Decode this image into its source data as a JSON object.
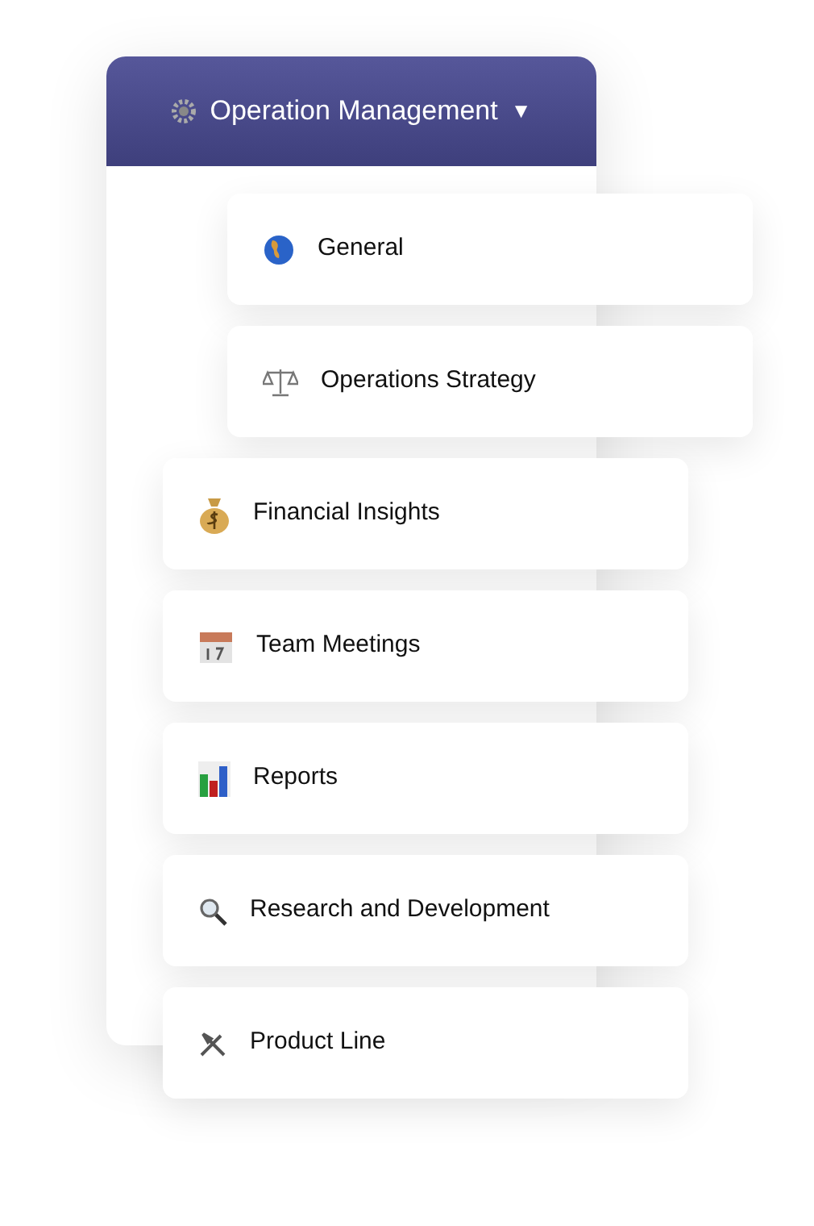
{
  "menu": {
    "title": "Operation Management",
    "caret": "▼",
    "expanded": true
  },
  "items": [
    {
      "label": "General",
      "kind": "sub"
    },
    {
      "label": "Operations Strategy",
      "kind": "sub"
    },
    {
      "label": "Financial Insights",
      "kind": "main"
    },
    {
      "label": "Team Meetings",
      "kind": "main"
    },
    {
      "label": "Reports",
      "kind": "main"
    },
    {
      "label": "Research and Development",
      "kind": "main"
    },
    {
      "label": "Product Line",
      "kind": "main"
    }
  ]
}
